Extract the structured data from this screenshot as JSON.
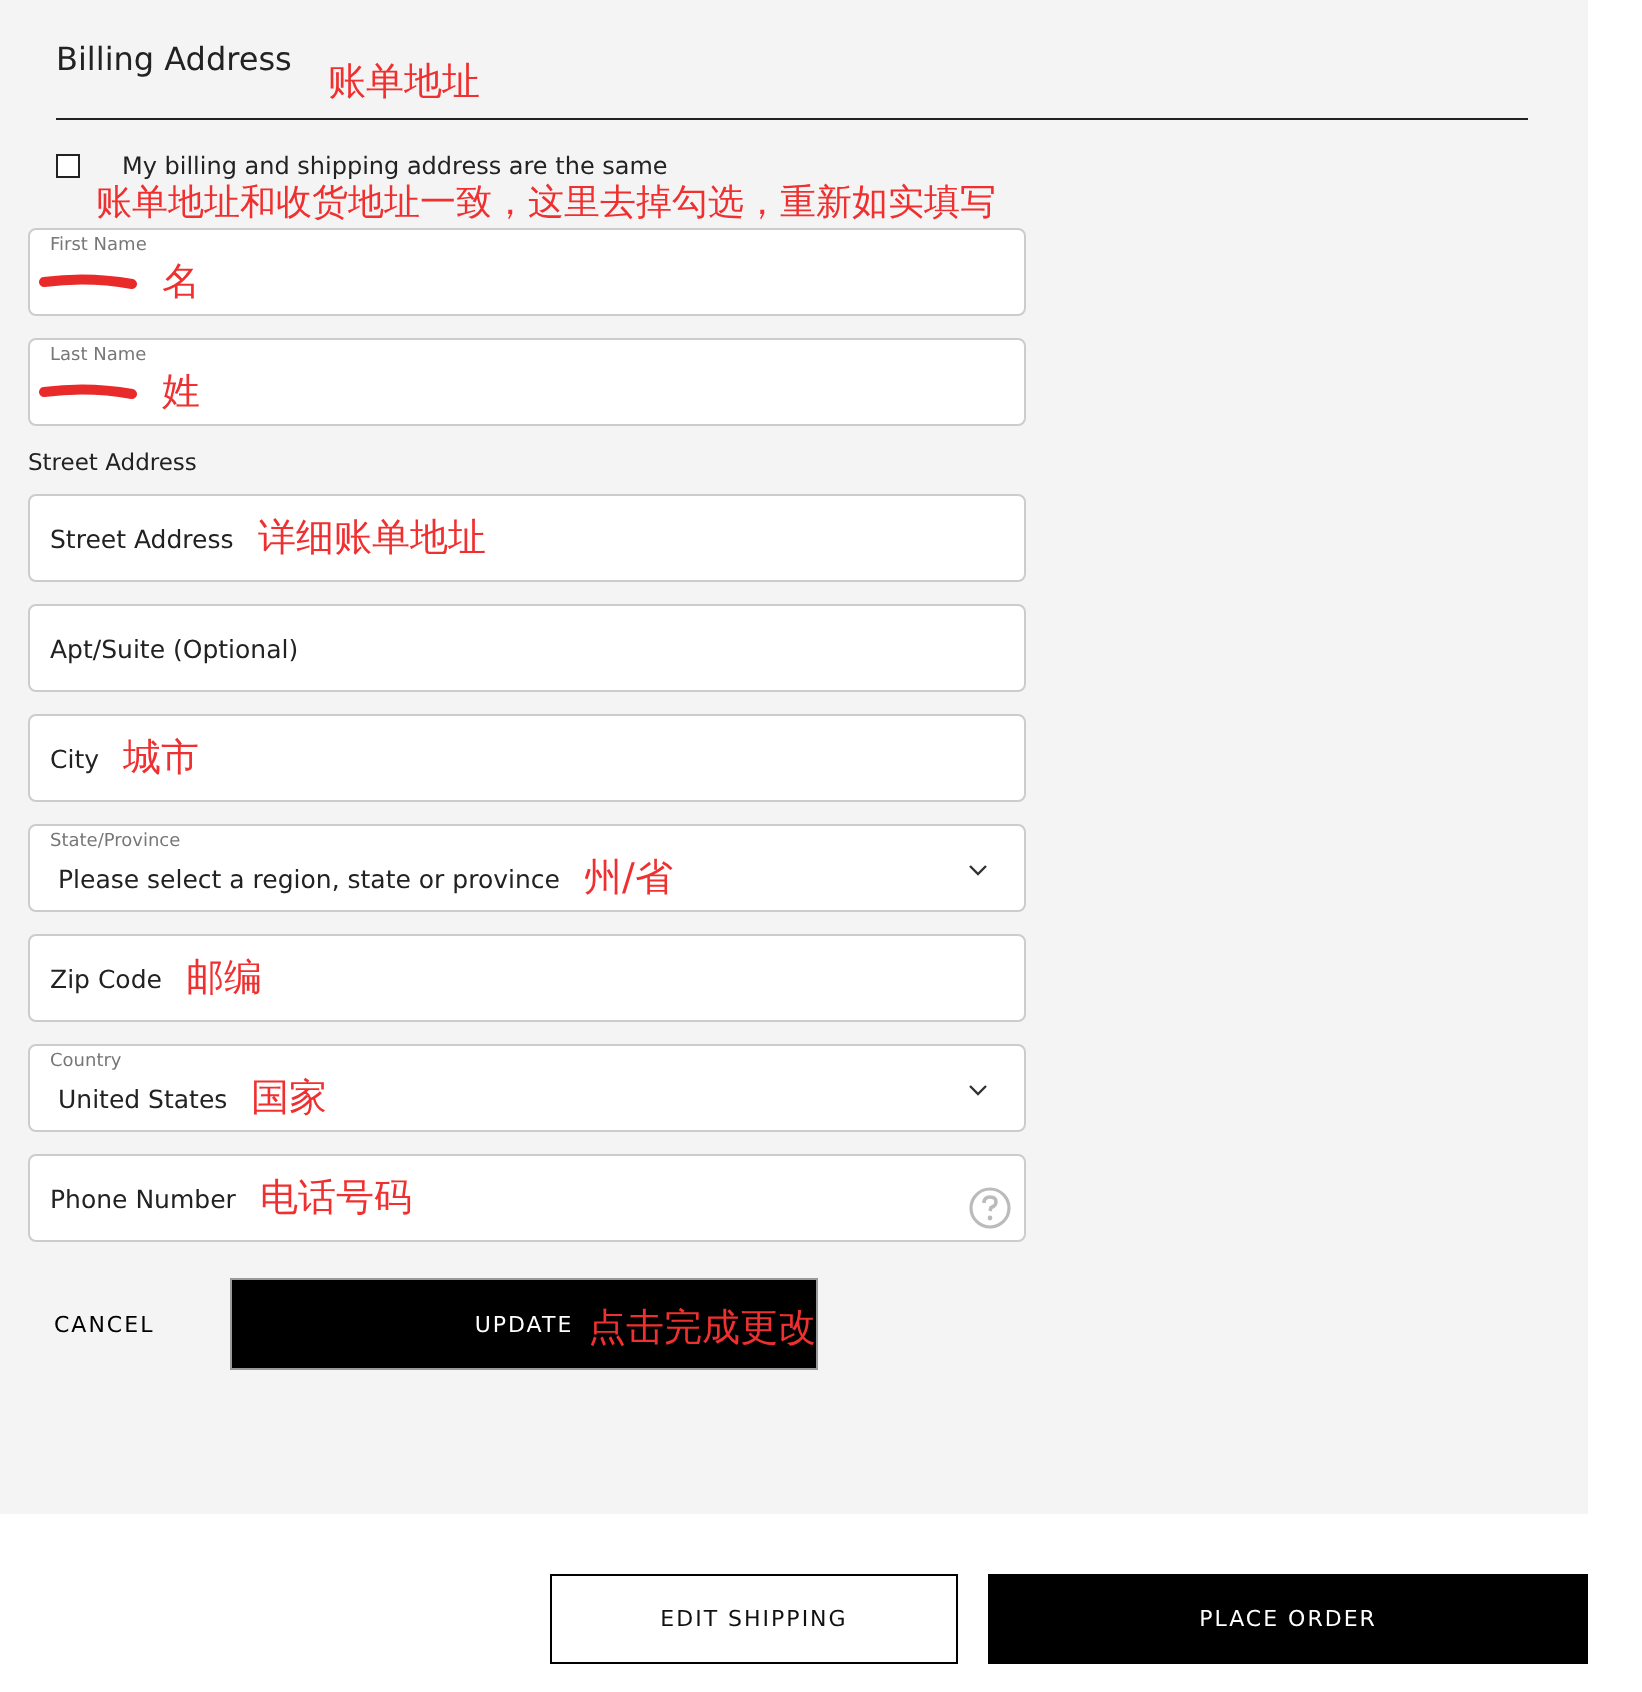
{
  "heading": {
    "title": "Billing Address",
    "note": "账单地址"
  },
  "same_address": {
    "label": "My billing and shipping address are the same",
    "checked": false,
    "note": "账单地址和收货地址一致，这里去掉勾选，重新如实填写"
  },
  "fields": [
    {
      "kind": "text",
      "label": "First Name",
      "redacted": true,
      "note": "名"
    },
    {
      "kind": "text",
      "label": "Last Name",
      "redacted": true,
      "note": "姓"
    },
    {
      "kind": "section",
      "label": "Street Address"
    },
    {
      "kind": "text",
      "placeholder": "Street Address",
      "note": "详细账单地址"
    },
    {
      "kind": "text",
      "placeholder": "Apt/Suite (Optional)"
    },
    {
      "kind": "text",
      "placeholder": "City",
      "note": "城市"
    },
    {
      "kind": "select",
      "label": "State/Province",
      "value": "Please select a region, state or province",
      "note": "州/省"
    },
    {
      "kind": "text",
      "placeholder": "Zip Code",
      "note": "邮编"
    },
    {
      "kind": "select",
      "label": "Country",
      "value": "United States",
      "note": "国家"
    },
    {
      "kind": "text",
      "placeholder": "Phone Number",
      "help": true,
      "note": "电话号码"
    }
  ],
  "actions": {
    "cancel": "CANCEL",
    "update": "UPDATE",
    "note": "点击完成更改"
  },
  "footer": {
    "edit": "EDIT SHIPPING",
    "place": "PLACE ORDER"
  }
}
